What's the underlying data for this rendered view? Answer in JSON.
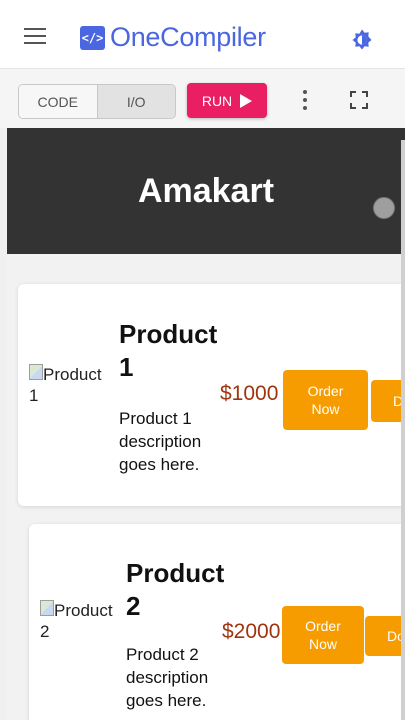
{
  "app": {
    "logo_glyph": "</>",
    "logo_text": "OneCompiler",
    "brand_color": "#4a66e0"
  },
  "toolbar": {
    "tabs": [
      {
        "label": "CODE"
      },
      {
        "label": "I/O",
        "selected": true
      }
    ],
    "run_label": "RUN",
    "run_color": "#e91e63"
  },
  "icons": {
    "menu": "hamburger-menu-icon",
    "theme": "theme-toggle-icon",
    "more": "more-vertical-icon",
    "fullscreen": "fullscreen-icon",
    "run": "play-icon"
  },
  "output": {
    "header_title": "Amakart",
    "header_bg": "#333333",
    "products": [
      {
        "image_alt_line1": "Product",
        "image_alt_line2": "1",
        "name_line1": "Product",
        "name_line2": "1",
        "desc_line1": "Product 1",
        "desc_line2": "description",
        "desc_line3": "goes here.",
        "price": "$1000",
        "order_line1": "Order",
        "order_line2": "Now",
        "extra_button": "D"
      },
      {
        "image_alt_line1": "Product",
        "image_alt_line2": "2",
        "name_line1": "Product",
        "name_line2": "2",
        "desc_line1": "Product 2",
        "desc_line2": "description",
        "desc_line3": "goes here.",
        "price": "$2000",
        "order_line1": "Order",
        "order_line2": "Now",
        "extra_button": "Do"
      }
    ],
    "button_color": "#f79c00",
    "price_color": "#a0340e"
  }
}
